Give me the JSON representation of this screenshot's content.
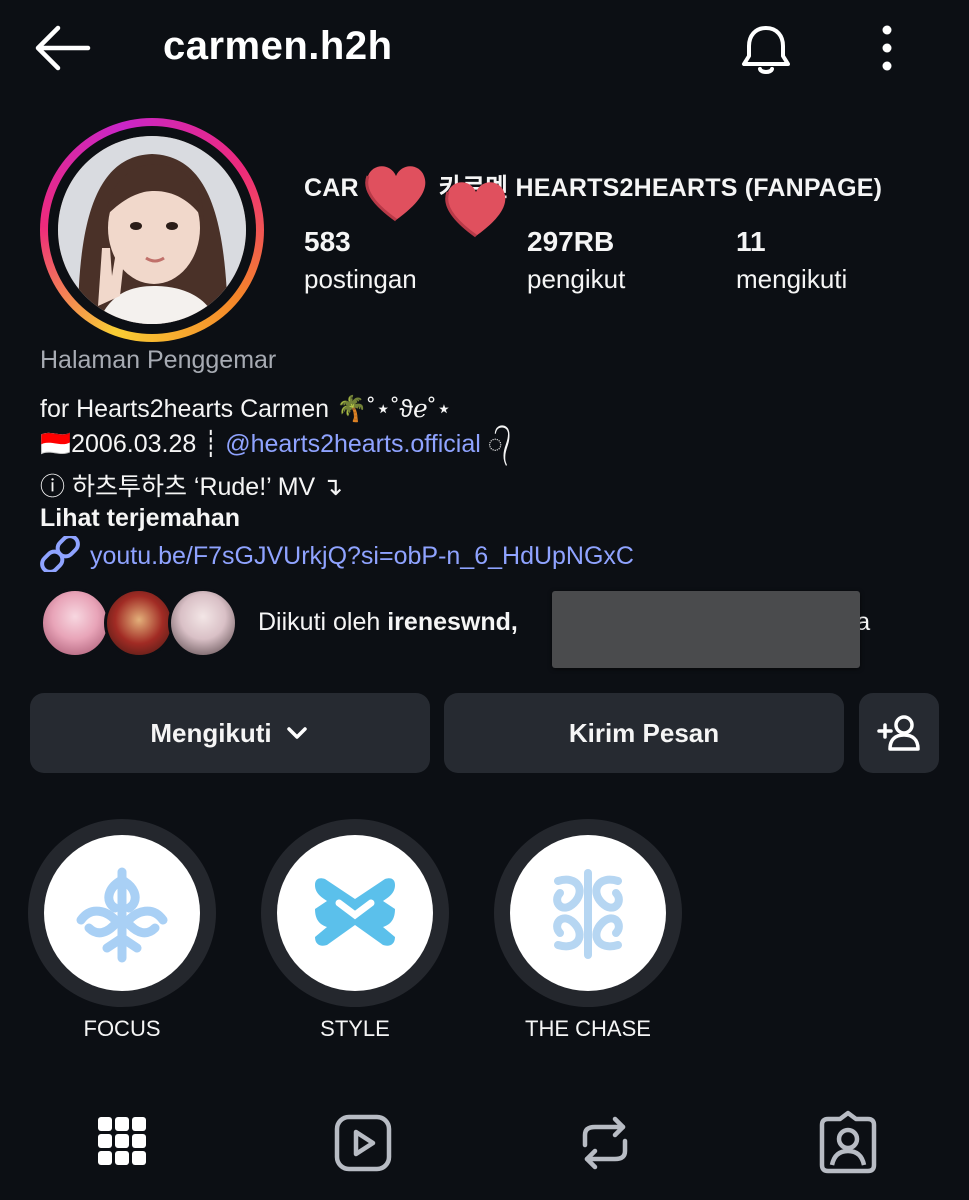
{
  "header": {
    "username": "carmen.h2h",
    "back_icon": "arrow-left-icon",
    "notification_icon": "bell-icon",
    "more_icon": "more-vertical-icon"
  },
  "profile": {
    "name_prefix": "CAR",
    "name_mid": "카르",
    "name_suffix": "멘 HEARTS2HEARTS (FANPAGE)",
    "stats": {
      "posts_count": "583",
      "posts_label": "postingan",
      "followers_count": "297RB",
      "followers_label": "pengikut",
      "following_count": "11",
      "following_label": "mengikuti"
    },
    "category": "Halaman Penggemar",
    "bio_line1": "for Hearts2hearts Carmen 🌴˚⋆˚ϑℯ˚⋆",
    "bio_line2_prefix": "🇮🇩2006.03.28 ┊ ",
    "bio_line2_mention": "@hearts2hearts.official",
    "bio_line2_suffix": " ᭄",
    "bio_line3": "ⓘ 하츠투하츠 ‘Rude!’ MV ↴",
    "see_translation": "Lihat terjemahan",
    "link": "youtu.be/F7sGJVUrkjQ?si=obP-n_6_HdUpNGxC",
    "followed_by_prefix": "Diikuti oleh ",
    "followed_by_name": "ireneswnd,",
    "followed_by_suffix": "nya"
  },
  "actions": {
    "following_label": "Mengikuti",
    "message_label": "Kirim Pesan",
    "add_user_icon": "add-user-icon"
  },
  "highlights": [
    {
      "label": "FOCUS"
    },
    {
      "label": "STYLE"
    },
    {
      "label": "THE CHASE"
    }
  ],
  "tabs": [
    {
      "icon": "grid-icon"
    },
    {
      "icon": "reels-icon"
    },
    {
      "icon": "repost-icon"
    },
    {
      "icon": "tagged-icon"
    }
  ],
  "colors": {
    "background": "#0c0f14",
    "button": "#262a31",
    "link": "#8fa3ff",
    "highlight_glyph": "#a9d0f5",
    "heart": "#e0505e"
  }
}
